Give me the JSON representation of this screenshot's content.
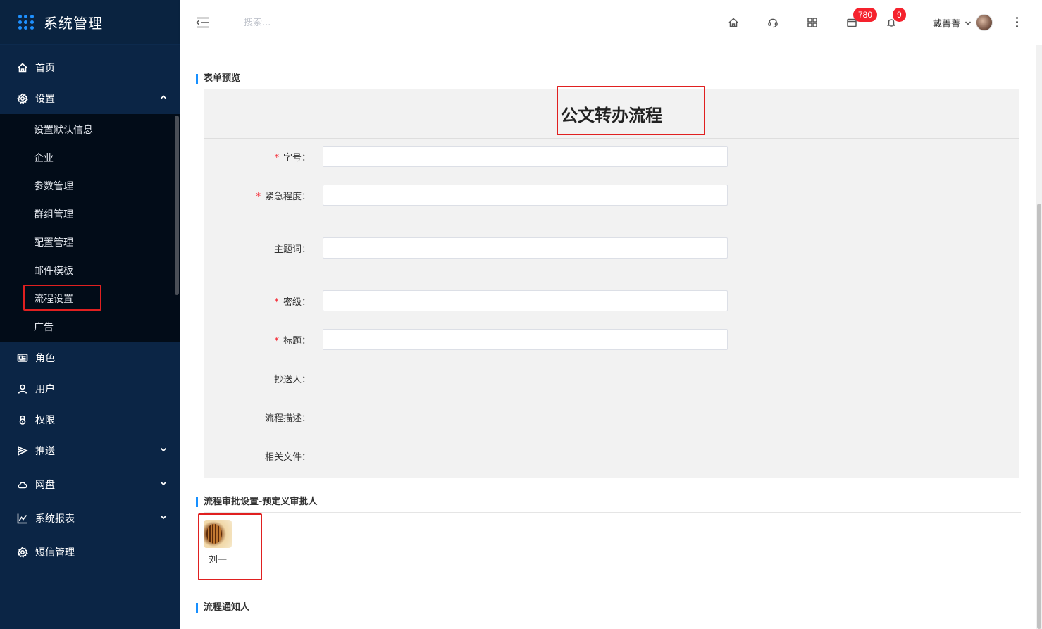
{
  "brand": {
    "title": "系统管理"
  },
  "sidebar": {
    "items": [
      {
        "label": "首页",
        "icon": "home-icon"
      },
      {
        "label": "设置",
        "icon": "gear-icon",
        "expanded": true
      },
      {
        "label": "角色",
        "icon": "id-card-icon"
      },
      {
        "label": "用户",
        "icon": "user-icon"
      },
      {
        "label": "权限",
        "icon": "lock-icon"
      },
      {
        "label": "推送",
        "icon": "send-icon"
      },
      {
        "label": "网盘",
        "icon": "cloud-icon"
      },
      {
        "label": "系统报表",
        "icon": "chart-icon"
      },
      {
        "label": "短信管理",
        "icon": "gear-icon"
      }
    ],
    "settings_sub": [
      {
        "label": "设置默认信息"
      },
      {
        "label": "企业"
      },
      {
        "label": "参数管理"
      },
      {
        "label": "群组管理"
      },
      {
        "label": "配置管理"
      },
      {
        "label": "邮件模板"
      },
      {
        "label": "流程设置",
        "active": true
      },
      {
        "label": "广告"
      }
    ]
  },
  "header": {
    "search_placeholder": "搜索...",
    "mail_badge": "780",
    "notify_badge": "9",
    "username": "戴菁菁"
  },
  "form_preview": {
    "section_title": "表单预览",
    "form_title": "公文转办流程",
    "fields": [
      {
        "label": "字号：",
        "required": true
      },
      {
        "label": "紧急程度：",
        "required": true
      },
      {
        "label": "主题词：",
        "required": false
      },
      {
        "label": "密级：",
        "required": true
      },
      {
        "label": "标题：",
        "required": true
      },
      {
        "label": "抄送人：",
        "required": false
      },
      {
        "label": "流程描述：",
        "required": false
      },
      {
        "label": "相关文件：",
        "required": false
      }
    ],
    "required_mark": "*"
  },
  "approval": {
    "section_title": "流程审批设置-预定义审批人",
    "approver_name": "刘一"
  },
  "notify": {
    "section_title": "流程通知人"
  },
  "colors": {
    "sidebar_bg": "#0b2545",
    "submenu_bg": "#020c18",
    "accent": "#1890ff",
    "badge": "#f5222d",
    "highlight": "#e02020"
  }
}
